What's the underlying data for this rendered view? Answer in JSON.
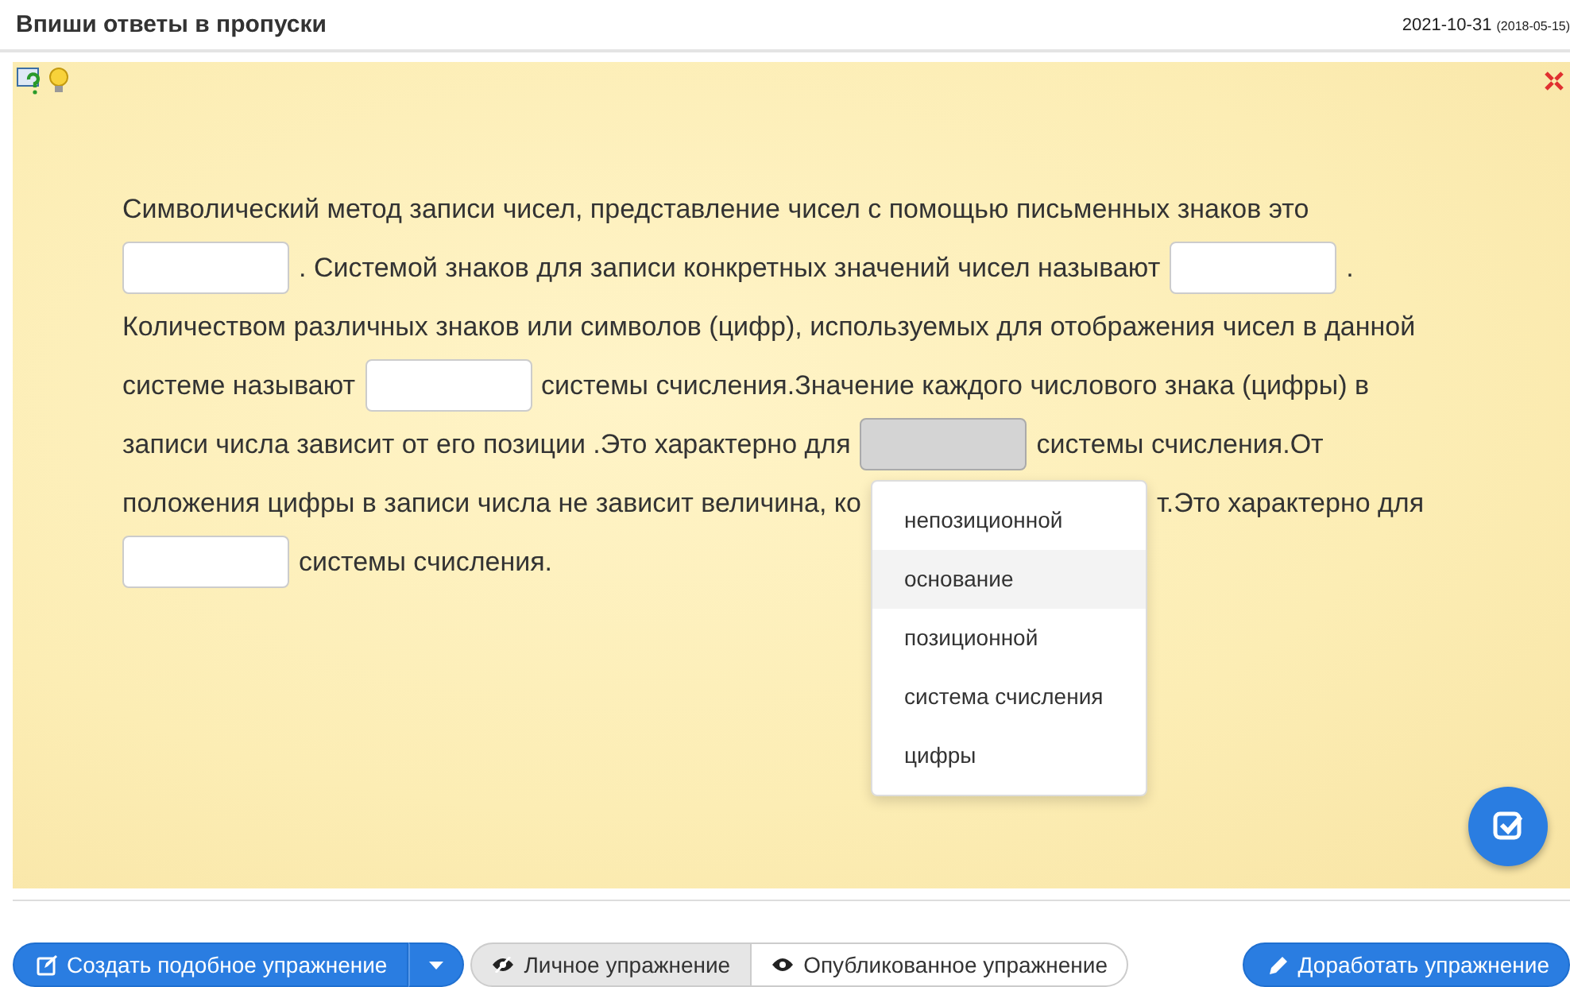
{
  "header": {
    "title": "Впиши ответы в пропуски",
    "date": "2021-10-31",
    "date_original": "(2018-05-15)"
  },
  "exercise": {
    "lines": [
      [
        {
          "kind": "text",
          "text": "Символический метод записи чисел, представление чисел с помощью письменных знаков это"
        }
      ],
      [
        {
          "kind": "blank",
          "open": false
        },
        {
          "kind": "text",
          "text": ". Системой знаков для записи конкретных значений чисел называют"
        },
        {
          "kind": "blank",
          "open": false
        },
        {
          "kind": "text",
          "text": "."
        }
      ],
      [
        {
          "kind": "text",
          "text": "Количеством различных знаков или символов (цифр), используемых для отображения чисел в данной"
        }
      ],
      [
        {
          "kind": "text",
          "text": "системе называют"
        },
        {
          "kind": "blank",
          "open": false
        },
        {
          "kind": "text",
          "text": "системы счисления.Значение каждого числового знака (цифры) в"
        }
      ],
      [
        {
          "kind": "text",
          "text": "записи числа зависит от его позиции .Это характерно для"
        },
        {
          "kind": "blank",
          "open": true
        },
        {
          "kind": "text",
          "text": "системы счисления.От"
        }
      ],
      [
        {
          "kind": "text",
          "text": "положения цифры в записи числа не зависит величина, ко"
        },
        {
          "kind": "covered"
        },
        {
          "kind": "text",
          "text": "т.Это характерно для"
        }
      ],
      [
        {
          "kind": "blank",
          "open": false
        },
        {
          "kind": "text",
          "text": "системы счисления."
        }
      ]
    ],
    "options": [
      {
        "label": "непозиционной",
        "selected": false
      },
      {
        "label": "основание",
        "selected": true
      },
      {
        "label": "позиционной",
        "selected": false
      },
      {
        "label": "система счисления",
        "selected": false
      },
      {
        "label": "цифры",
        "selected": false
      }
    ]
  },
  "footer": {
    "create_button": "Создать подобное упражнение",
    "views": [
      {
        "label": "Личное упражнение",
        "selected": true
      },
      {
        "label": "Опубликованное упражнение",
        "selected": false
      }
    ],
    "improve_button": "Доработать упражнение"
  }
}
